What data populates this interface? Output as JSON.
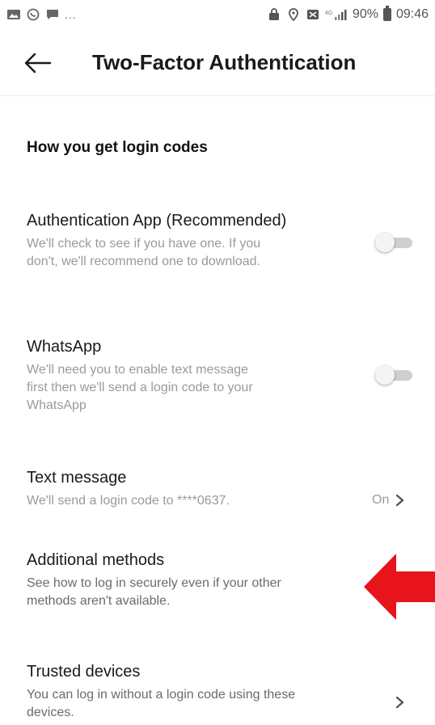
{
  "status_bar": {
    "dots": "...",
    "signal_text": "⁴ᴳ",
    "battery_percent": "90%",
    "time": "09:46"
  },
  "header": {
    "title": "Two-Factor Authentication"
  },
  "section": {
    "title": "How you get login codes"
  },
  "methods": [
    {
      "title": "Authentication App (Recommended)",
      "desc_line1": "We'll check to see if you have one. If you",
      "desc_line2": "don't, we'll recommend one to download.",
      "toggle_on": false
    },
    {
      "title": "WhatsApp",
      "desc_line1": "We'll need you to enable text message",
      "desc_line2": "first then we'll send a login code to your",
      "desc_line3": "WhatsApp",
      "toggle_on": false
    },
    {
      "title": "Text message",
      "desc_line1": "We'll send a login code to ****0637.",
      "status": "On"
    },
    {
      "title": "Additional methods",
      "desc_line1": "See how to log in securely even if your other",
      "desc_line2": "methods aren't available."
    },
    {
      "title": "Trusted devices",
      "desc_line1": "You can log in without a login code using these",
      "desc_line2": "devices."
    }
  ],
  "colors": {
    "annotation_arrow": "#e8141c",
    "toggle_track": "#cfcfcf",
    "secondary_text": "#9a9a9a"
  }
}
